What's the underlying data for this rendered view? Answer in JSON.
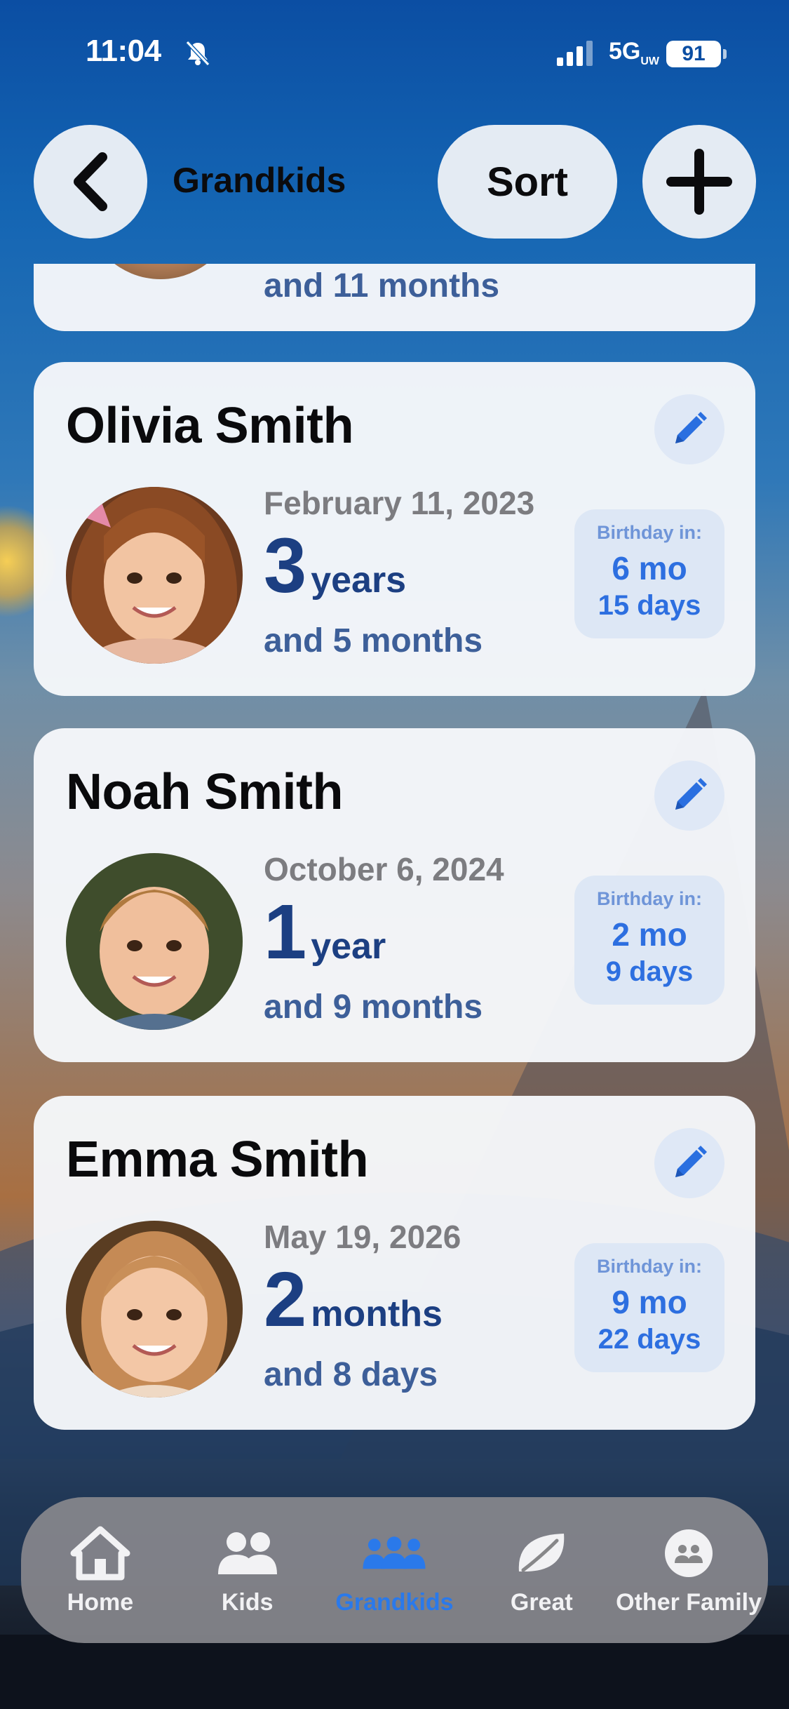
{
  "status_bar": {
    "time": "11:04",
    "network": "5G",
    "network_suffix": "UW",
    "battery": "91"
  },
  "header": {
    "title": "Grandkids",
    "sort_label": "Sort"
  },
  "partial_card": {
    "age_sub": "and 11 months"
  },
  "cards": [
    {
      "name": "Olivia Smith",
      "birthdate": "February 11, 2023",
      "age_num": "3",
      "age_unit": "years",
      "age_sub": "and 5 months",
      "birthday_label": "Birthday in:",
      "birthday_months": "6 mo",
      "birthday_days": "15 days"
    },
    {
      "name": "Noah Smith",
      "birthdate": "October 6, 2024",
      "age_num": "1",
      "age_unit": "year",
      "age_sub": "and 9 months",
      "birthday_label": "Birthday in:",
      "birthday_months": "2 mo",
      "birthday_days": "9 days"
    },
    {
      "name": "Emma Smith",
      "birthdate": "May 19, 2026",
      "age_num": "2",
      "age_unit": "months",
      "age_sub": "and 8 days",
      "birthday_label": "Birthday in:",
      "birthday_months": "9 mo",
      "birthday_days": "22 days"
    }
  ],
  "tabs": [
    {
      "label": "Home",
      "icon": "house-icon",
      "active": false
    },
    {
      "label": "Kids",
      "icon": "two-people-icon",
      "active": false
    },
    {
      "label": "Grandkids",
      "icon": "group-icon",
      "active": true
    },
    {
      "label": "Great",
      "icon": "leaf-icon",
      "active": false
    },
    {
      "label": "Other Family",
      "icon": "family-circle-icon",
      "active": false
    }
  ],
  "colors": {
    "accent": "#2a79ea",
    "age_primary": "#1c3f82",
    "age_secondary": "#3d5f99",
    "card_bg": "#f5f7fa",
    "pill_bg": "#dde7f5"
  }
}
